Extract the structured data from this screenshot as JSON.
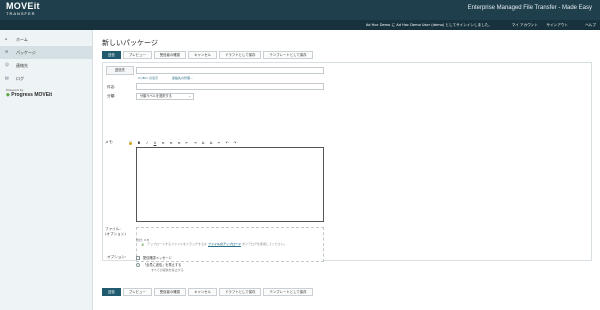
{
  "header": {
    "logo_main": "MOVEit",
    "logo_sub": "TRANSFER",
    "title": "Enterprise Managed File Transfer - Made Easy"
  },
  "nav": {
    "user_text": "Ad Hoc Demo に Ad Hoc Demo User (demo) としてサインインしました。",
    "my_account": "マイ アカウント",
    "sign_out": "サインアウト",
    "help": "ヘルプ"
  },
  "sidebar": {
    "items": [
      {
        "label": "ホーム",
        "icon": "home-icon"
      },
      {
        "label": "パッケージ",
        "icon": "package-icon"
      },
      {
        "label": "連絡先",
        "icon": "contacts-icon"
      },
      {
        "label": "ログ",
        "icon": "log-icon"
      }
    ],
    "powered_by": "Powered by",
    "progress_brand": "Progress MOVEit"
  },
  "page": {
    "title": "新しいパッケージ"
  },
  "actions": {
    "send": "送信",
    "preview": "プレビュー",
    "recipient_check": "受信者の確認",
    "cancel": "キャンセル",
    "save_draft": "ドラフトとして保存",
    "save_template": "テンプレートとして保存"
  },
  "form": {
    "to_button": "送信先",
    "cc_bcc_link": "Cc/Bcc の表示",
    "contacts_link": "連絡先の管理...",
    "subject_label": "件名:",
    "classification_label": "分類:",
    "classification_value": "分類ラベルを選択する",
    "message_label": "メモ:",
    "toolbar": [
      "B",
      "I",
      "U",
      "≡",
      "≡",
      "≡",
      "⇤",
      "⇥",
      "≣",
      "≣",
      "↵",
      "↶",
      "↷"
    ],
    "file_label": "ファイル:",
    "file_optional": "(オプション)",
    "dz_before": "アップロードするファイルをドラッグするか",
    "dz_link": "ファイルのアップロード",
    "dz_after": "ダイアログを使用してください。",
    "total_label": "合計: 0 B",
    "options_label": "オプション:",
    "opt_read_receipt": "配信確認メッセージ",
    "opt_reply_all": "「全員に返信」を禁止する",
    "opt_reply_all_sub": "すべての返信を禁止する"
  }
}
